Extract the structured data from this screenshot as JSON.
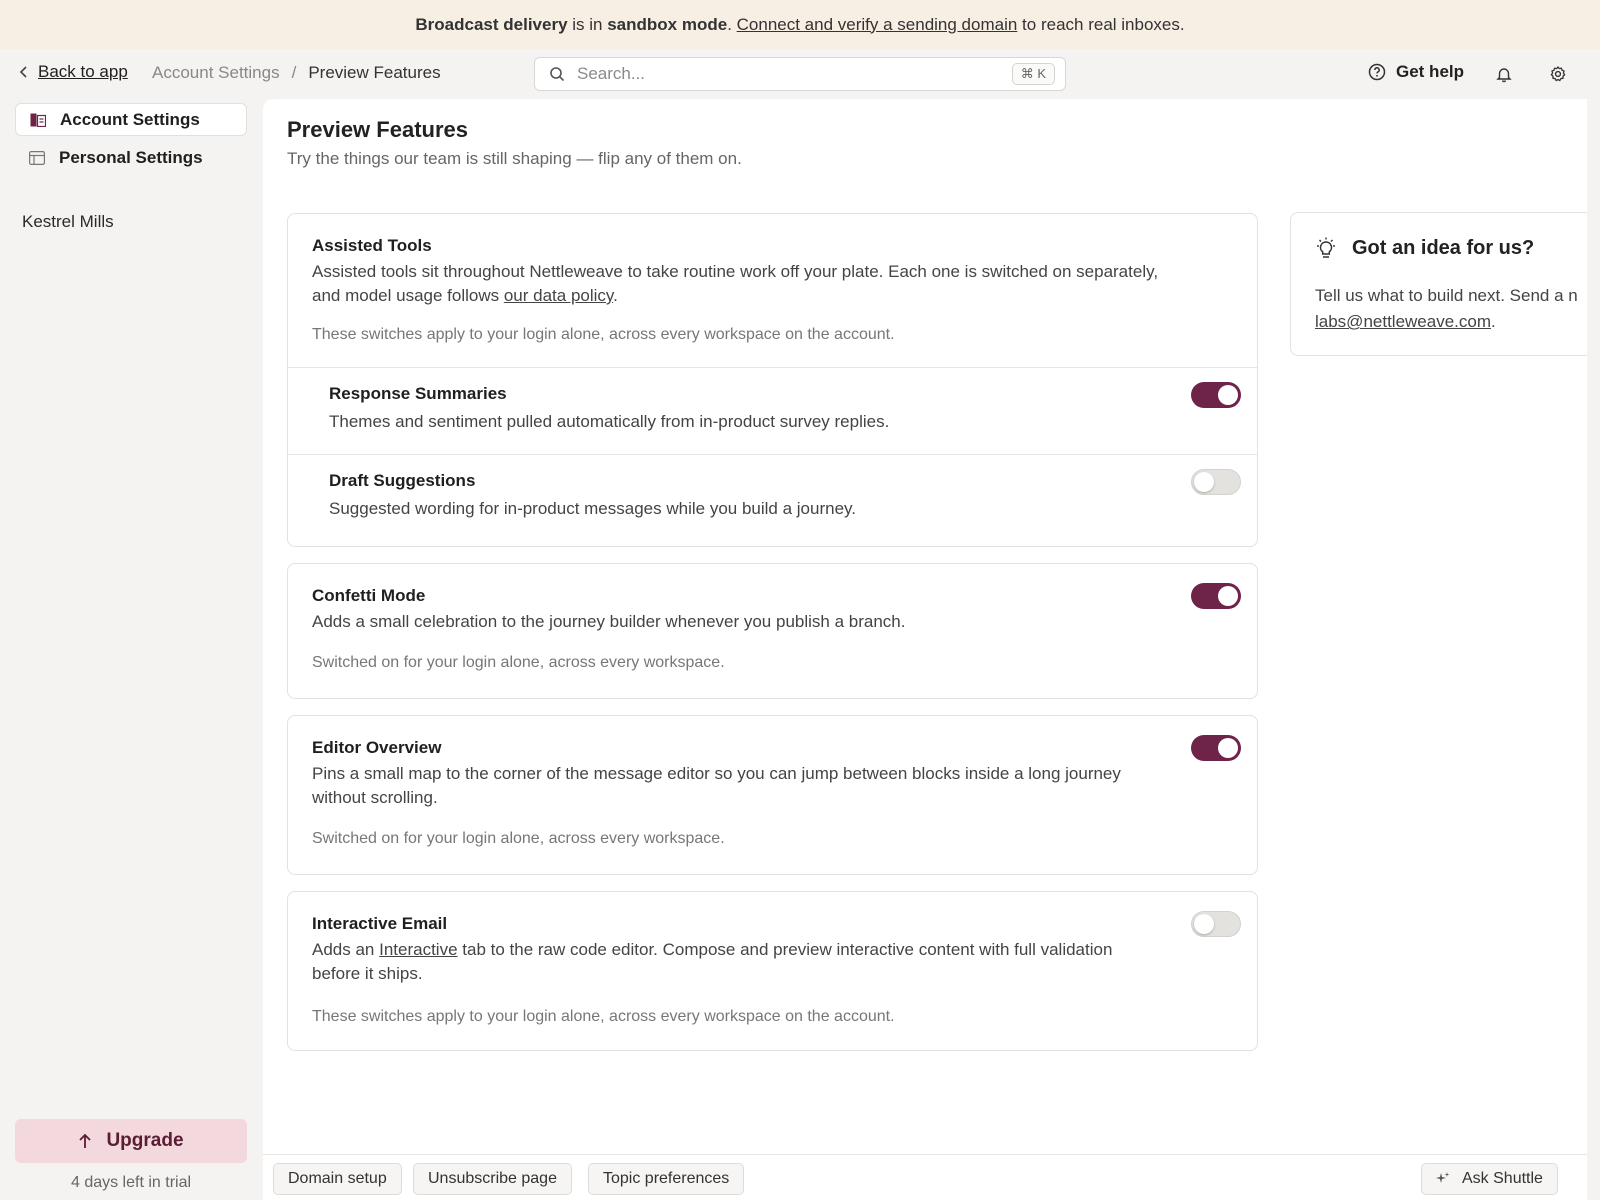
{
  "banner": {
    "part1": "Broadcast delivery",
    "part2": " is in ",
    "part3": "sandbox mode",
    "part4": ". ",
    "link": "Connect and verify a sending domain",
    "part5": " to reach real inboxes."
  },
  "topbar": {
    "back_label": "Back to app",
    "breadcrumb": [
      "Account Settings",
      "/",
      "Preview Features"
    ],
    "search_placeholder": "Search...",
    "search_shortcut": "⌘ K",
    "help_label": "Get help"
  },
  "sidebar": {
    "items": [
      {
        "label": "Account Settings",
        "icon": "account-settings-icon",
        "active": true
      },
      {
        "label": "Personal Settings",
        "icon": "personal-settings-icon",
        "active": false
      }
    ],
    "user_name": "Kestrel Mills",
    "upgrade_label": "Upgrade",
    "trial_text": "4 days left in trial"
  },
  "page": {
    "title": "Preview Features",
    "subtitle": "Try the things our team is still shaping — flip any of them on."
  },
  "assisted": {
    "title": "Assisted Tools",
    "desc_part1": "Assisted tools sit throughout Nettleweave to take routine work off your plate. Each one is switched on separately,",
    "desc_part2": "and model usage follows ",
    "desc_link": "our data policy",
    "desc_part3": ".",
    "note": "These switches apply to your login alone, across every workspace on the account.",
    "features": [
      {
        "title": "Response Summaries",
        "desc": "Themes and sentiment pulled automatically from in-product survey replies.",
        "enabled": true
      },
      {
        "title": "Draft Suggestions",
        "desc": "Suggested wording for in-product messages while you build a journey.",
        "enabled": false
      }
    ]
  },
  "confetti": {
    "title": "Confetti Mode",
    "desc": "Adds a small celebration to the journey builder whenever you publish a branch.",
    "note": "Switched on for your login alone, across every workspace.",
    "enabled": true
  },
  "editor_overview": {
    "title": "Editor Overview",
    "desc_line1": "Pins a small map to the corner of the message editor so you can jump between blocks inside a long journey",
    "desc_line2": "without scrolling.",
    "note": "Switched on for your login alone, across every workspace.",
    "enabled": true
  },
  "interactive_email": {
    "title": "Interactive Email",
    "desc_part1": "Adds an ",
    "desc_link": "Interactive",
    "desc_part2": " tab to the raw code editor. Compose and preview interactive content with full validation",
    "desc_line2": "before it ships.",
    "note": "These switches apply to your login alone, across every workspace on the account.",
    "enabled": false
  },
  "idea": {
    "title": "Got an idea for us?",
    "text": "Tell us what to build next. Send a n",
    "email": "labs@nettleweave.com",
    "text_end": "."
  },
  "footer": {
    "buttons": [
      "Domain setup",
      "Unsubscribe page",
      "Topic preferences"
    ],
    "ask_label": "Ask Shuttle"
  },
  "colors": {
    "accent": "#6e2448",
    "banner_bg": "#f7efe4",
    "upgrade_bg": "#f3d8de"
  }
}
